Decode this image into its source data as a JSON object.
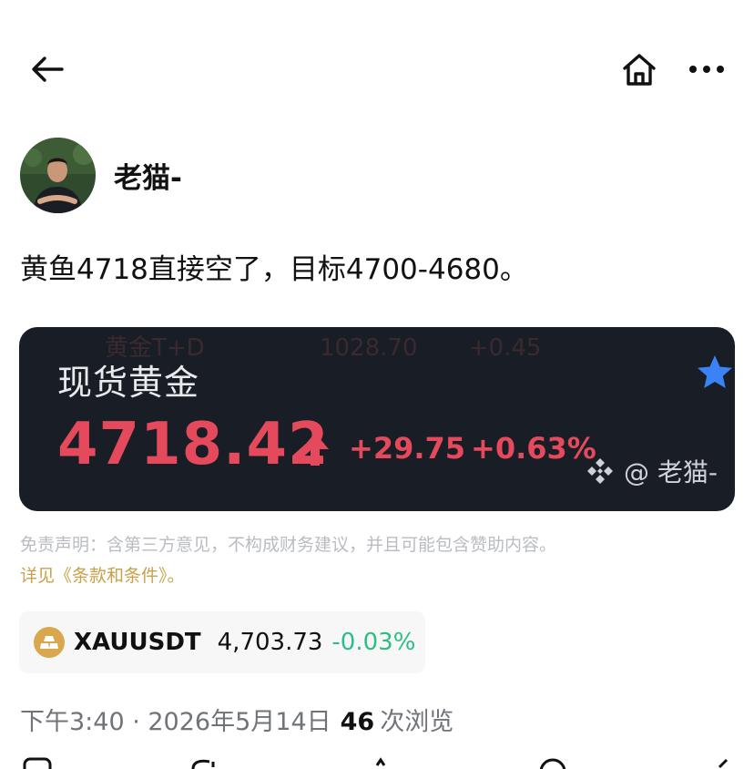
{
  "nav": {
    "back_icon": "back-arrow-icon",
    "home_icon": "home-icon",
    "more_icon": "more-horizontal-icon"
  },
  "author": {
    "name": "老猫-"
  },
  "post": {
    "text": "黄鱼4718直接空了，目标4700-4680。"
  },
  "card": {
    "ghost_label": "黄金T+D",
    "ghost_value": "1028.70",
    "ghost_change": "+0.45",
    "title": "现货黄金",
    "price": "4718.42",
    "change": "+29.75",
    "change_pct": "+0.63%",
    "watermark": "@ 老猫-",
    "price_color": "#e4495c",
    "star_color": "#3b82f6"
  },
  "disclaimer": {
    "text": "免责声明：含第三方意见，不构成财务建议，并且可能包含赞助内容。",
    "terms_link": "详见《条款和条件》。"
  },
  "ticker": {
    "symbol": "XAUUSDT",
    "price": "4,703.73",
    "change": "-0.03%",
    "change_color": "#2dbd85"
  },
  "meta": {
    "time": "下午3:40 · 2026年5月14日",
    "views": "46",
    "views_label": "次浏览"
  },
  "accent": {
    "gold": "#c8a24a"
  }
}
